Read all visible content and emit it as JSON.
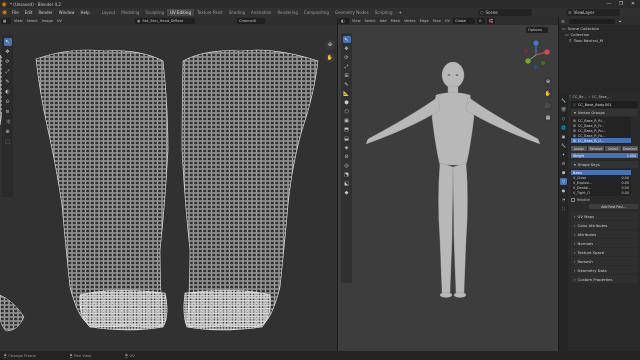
{
  "window": {
    "title": "* (Unsaved) - Blender 4.2",
    "minimize": "—",
    "maximize": "❐",
    "close": "✕"
  },
  "menus": [
    "File",
    "Edit",
    "Render",
    "Window",
    "Help"
  ],
  "workspaces": [
    {
      "label": "Layout",
      "active": false
    },
    {
      "label": "Modeling",
      "active": false
    },
    {
      "label": "Sculpting",
      "active": false
    },
    {
      "label": "UV Editing",
      "active": true
    },
    {
      "label": "Texture Paint",
      "active": false
    },
    {
      "label": "Shading",
      "active": false
    },
    {
      "label": "Animation",
      "active": false
    },
    {
      "label": "Rendering",
      "active": false
    },
    {
      "label": "Compositing",
      "active": false
    },
    {
      "label": "Geometry Nodes",
      "active": false
    },
    {
      "label": "Scripting",
      "active": false
    }
  ],
  "add_workspace": "+",
  "scene": {
    "label": "Scene",
    "view_layer": "ViewLayer"
  },
  "uv_editor": {
    "header_menus": [
      "View",
      "Select",
      "Image",
      "UV"
    ],
    "image_name": "Std_Skin_Head_Diffuse",
    "uv_map": "Channel0",
    "tools": [
      "↖",
      "✥",
      "⟳",
      "⤢",
      "✎",
      "◐",
      "⊙",
      "≡",
      "⤨",
      "⊕",
      "⬚"
    ]
  },
  "viewport": {
    "header_menus": [
      "View",
      "Select",
      "Add",
      "Mesh",
      "Vertex",
      "Edge",
      "Face",
      "UV"
    ],
    "orientation": "Global",
    "options_label": "Options",
    "tools": [
      "↖",
      "✥",
      "⟳",
      "⤢",
      "⊞",
      "✎",
      "📐",
      "⬢",
      "⬡",
      "▣",
      "⬒",
      "⬓",
      "◈",
      "⊘",
      "◎",
      "⬔",
      "⬕",
      "◆"
    ]
  },
  "outliner": {
    "rows": [
      "Scene Collection",
      "Collection",
      "Toon Neutral_M"
    ]
  },
  "properties": {
    "object_name": "CC_Base_Body.001",
    "breadcrumb": [
      "CC_Ba...",
      "CC_Base_..."
    ],
    "vertex_groups": {
      "title": "Vertex Groups",
      "items": [
        "CC_Base_R_Ri...",
        "CC_Base_R_Fr...",
        "CC_Base_R_Ru...",
        "CC_Base_R_Fo...",
        "CC_Base_R_U..."
      ],
      "buttons": [
        "Assign",
        "Remove",
        "Select",
        "Deselect"
      ],
      "weight_label": "Weight",
      "weight_value": "1.000"
    },
    "shape_keys": {
      "title": "Shape Keys",
      "items": [
        {
          "name": "Basis",
          "value": ""
        },
        {
          "name": "V_Close",
          "value": "0.00"
        },
        {
          "name": "V_Explosi...",
          "value": "0.00"
        },
        {
          "name": "V_Dental...",
          "value": "0.00"
        },
        {
          "name": "V_Tight_O",
          "value": "0.00"
        }
      ],
      "relative_label": "Relative",
      "add_rest_label": "Add Rest Posi..."
    },
    "collapsed_panels": [
      "UV Maps",
      "Color Attributes",
      "Attributes",
      "Normals",
      "Texture Space",
      "Remesh",
      "Geometry Data",
      "Custom Properties"
    ]
  },
  "statusbar": {
    "items": [
      "Change Frame",
      "Pan View",
      "UV"
    ]
  },
  "colors": {
    "accent": "#4772b3",
    "mesh": "#b4b4b4",
    "uv_wire": "#e0e0e0"
  }
}
